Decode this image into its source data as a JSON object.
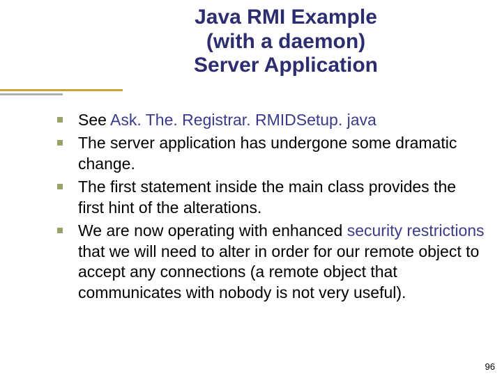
{
  "title": {
    "line1": "Java RMI Example",
    "line2": "(with a daemon)",
    "line3": "Server Application"
  },
  "bullets": [
    {
      "pre": "See ",
      "hl": "Ask. The. Registrar. RMIDSetup. java",
      "post": ""
    },
    {
      "pre": "The server application has undergone some dramatic change.",
      "hl": "",
      "post": ""
    },
    {
      "pre": "The first statement inside the main class provides the first hint of the alterations.",
      "hl": "",
      "post": ""
    },
    {
      "pre": "We are now operating with enhanced ",
      "hl": "security restrictions",
      "post": " that we will need to alter in order for our remote object to accept any connections (a remote object that communicates with nobody is not very useful)."
    }
  ],
  "page_number": "96"
}
